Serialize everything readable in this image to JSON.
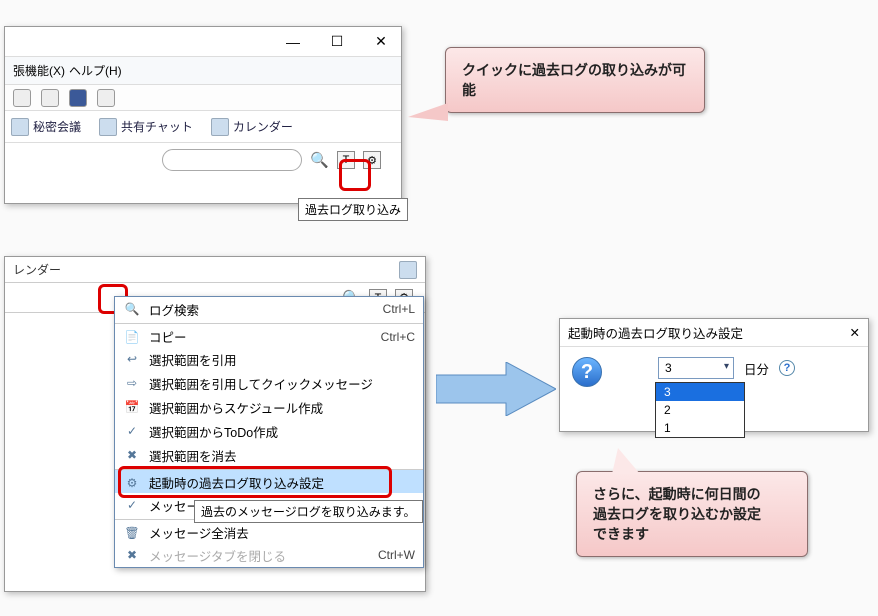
{
  "win1": {
    "menu": {
      "ext": "張機能(X)",
      "help": "ヘルプ(H)"
    },
    "toolbar": {
      "secret": "秘密会議",
      "chat": "共有チャット",
      "calendar": "カレンダー"
    },
    "tooltip": "過去ログ取り込み"
  },
  "callout1": "クイックに過去ログの取り込みが可能",
  "callout2_l1": "さらに、起動時に何日間の",
  "callout2_l2": "過去ログを取り込むか設定",
  "callout2_l3": "できます",
  "win2": {
    "top_cal": "レンダー"
  },
  "ctx": [
    {
      "icon": "🔍",
      "label": "ログ検索",
      "shortcut": "Ctrl+L"
    },
    {
      "icon": "📄",
      "label": "コピー",
      "shortcut": "Ctrl+C",
      "sep": true
    },
    {
      "icon": "↩",
      "label": "選択範囲を引用"
    },
    {
      "icon": "⇨",
      "label": "選択範囲を引用してクイックメッセージ"
    },
    {
      "icon": "📅",
      "label": "選択範囲からスケジュール作成"
    },
    {
      "icon": "✓",
      "label": "選択範囲からToDo作成"
    },
    {
      "icon": "✖",
      "label": "選択範囲を消去"
    },
    {
      "icon": "⚙",
      "label": "起動時の過去ログ取り込み設定",
      "sep": true,
      "hi": true
    },
    {
      "icon": "✓",
      "label": "メッセージスレッド表示"
    },
    {
      "icon": "🗑",
      "label": "メッセージ全消去",
      "sep": true
    },
    {
      "icon": "✖",
      "label": "メッセージタブを閉じる",
      "shortcut": "Ctrl+W",
      "dis": true
    }
  ],
  "ctx_tip": "過去のメッセージログを取り込みます。",
  "dlg": {
    "title": "起動時の過去ログ取り込み設定",
    "value": "3",
    "suffix": "日分",
    "options": [
      "3",
      "2",
      "1"
    ]
  }
}
